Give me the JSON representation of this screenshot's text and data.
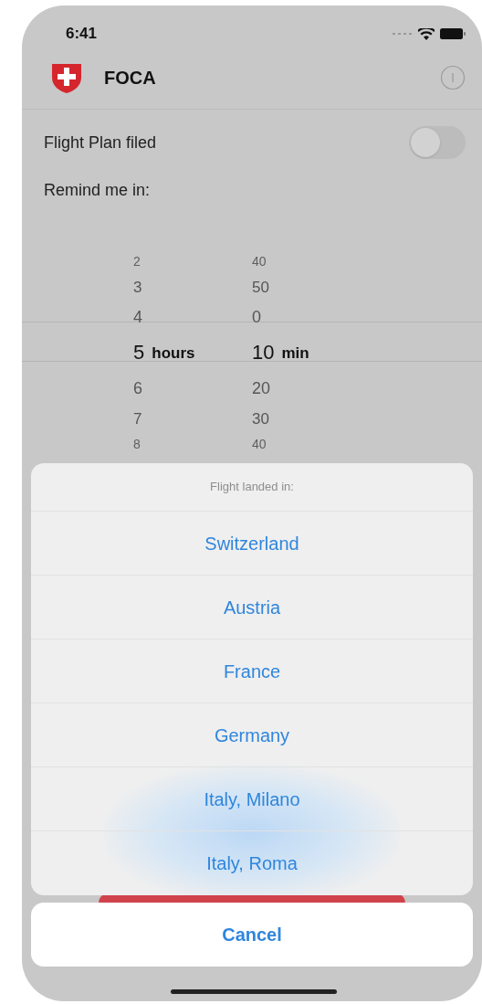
{
  "status_bar": {
    "time": "6:41"
  },
  "header": {
    "title": "FOCA"
  },
  "settings": [
    {
      "kind": "toggle",
      "label": "Flight Plan filed",
      "on": false
    },
    {
      "kind": "text",
      "label": "Remind me in:"
    }
  ],
  "picker": {
    "columns": [
      {
        "unit": "hours",
        "items": [
          {
            "value": "2",
            "selected": false
          },
          {
            "value": "3",
            "selected": false
          },
          {
            "value": "4",
            "selected": false
          },
          {
            "value": "5",
            "selected": true
          },
          {
            "value": "6",
            "selected": false
          },
          {
            "value": "7",
            "selected": false
          },
          {
            "value": "8",
            "selected": false
          }
        ]
      },
      {
        "unit": "min",
        "items": [
          {
            "value": "40",
            "selected": false
          },
          {
            "value": "50",
            "selected": false
          },
          {
            "value": "0",
            "selected": false
          },
          {
            "value": "10",
            "selected": true
          },
          {
            "value": "20",
            "selected": false
          },
          {
            "value": "30",
            "selected": false
          },
          {
            "value": "40",
            "selected": false
          }
        ]
      }
    ]
  },
  "action_sheet": {
    "title": "Flight landed in:",
    "options": [
      "Switzerland",
      "Austria",
      "France",
      "Germany",
      "Italy, Milano",
      "Italy, Roma"
    ],
    "cancel": "Cancel"
  }
}
